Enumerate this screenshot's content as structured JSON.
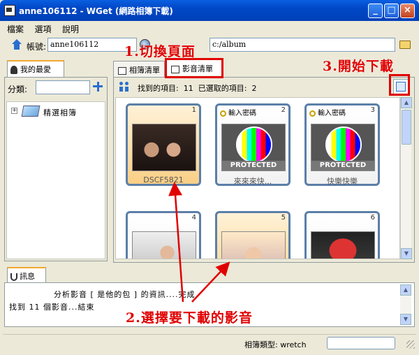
{
  "window": {
    "title": "anne106112 - WGet (網路相簿下載)"
  },
  "menu": [
    "檔案",
    "選項",
    "說明"
  ],
  "account": {
    "label": "帳號:",
    "value": "anne106112",
    "path": "c:/album"
  },
  "left": {
    "tab": "我的最愛",
    "category_label": "分類:",
    "tree": [
      {
        "label": "精選相簿"
      }
    ]
  },
  "main": {
    "tabs": [
      {
        "label": "相簿清單"
      },
      {
        "label": "影音清單"
      }
    ],
    "found_label": "找到的項目:",
    "found_count": "11",
    "selected_label": "已選取的項目:",
    "selected_count": "2",
    "items": [
      {
        "num": "1",
        "caption": "DSCF5821",
        "selected": true,
        "locked": false,
        "thumb": "photo"
      },
      {
        "num": "2",
        "caption": "來來來快...",
        "selected": false,
        "locked": true,
        "pw": "輸入密碼",
        "protected": "PROTECTED",
        "thumb": "test-pattern"
      },
      {
        "num": "3",
        "caption": "快樂快樂",
        "selected": false,
        "locked": true,
        "pw": "輸入密碼",
        "protected": "PROTECTED",
        "thumb": "test-pattern"
      },
      {
        "num": "4",
        "selected": false,
        "thumb": "photo"
      },
      {
        "num": "5",
        "selected": true,
        "thumb": "photo"
      },
      {
        "num": "6",
        "selected": false,
        "thumb": "photo"
      }
    ]
  },
  "messages": {
    "tab": "訊息",
    "lines": [
      "分析影音 [ 是他的包 ] 的資訊....完成",
      "找到 11 個影音...結束"
    ]
  },
  "status": {
    "label": "相簿類型: wretch",
    "field": ""
  },
  "annotations": {
    "step1": "1.切換頁面",
    "step2": "2.選擇要下載的影音",
    "step3": "3.開始下載",
    "color": "#e00000"
  },
  "colors": {
    "titlebar": "#0047c6",
    "selected_card": "#f9cf86",
    "card_border": "#5b7fa8"
  }
}
